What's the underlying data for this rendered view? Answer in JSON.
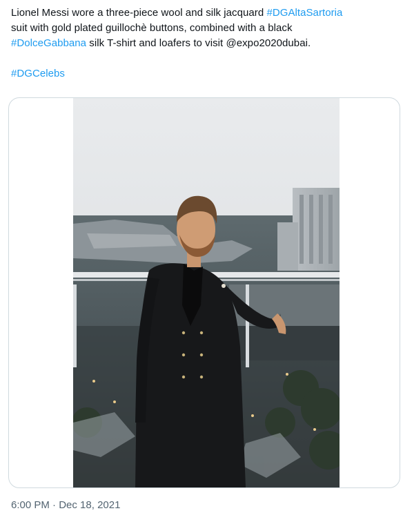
{
  "tweet": {
    "line1_text": "Lionel Messi wore a three-piece wool and silk jacquard ",
    "hashtag_1": "#DGAltaSartoria",
    "line2_text": "suit with gold plated guillochè buttons, combined with a black",
    "hashtag_2": "#DolceGabbana",
    "line3_text": " silk T-shirt and loafers to visit ",
    "mention": "@expo2020dubai",
    "line3_end": ".",
    "hashtag_3": "#DGCelebs"
  },
  "media": {
    "photo_alt": "Man in a black double-breasted suit standing at a rooftop railing above an expo site"
  },
  "meta": {
    "time": "6:00 PM",
    "separator": " · ",
    "date": "Dec 18, 2021"
  },
  "colors": {
    "link": "#1d9bf0",
    "text": "#0f1419",
    "secondary": "#536471",
    "border": "#cfd9de"
  }
}
